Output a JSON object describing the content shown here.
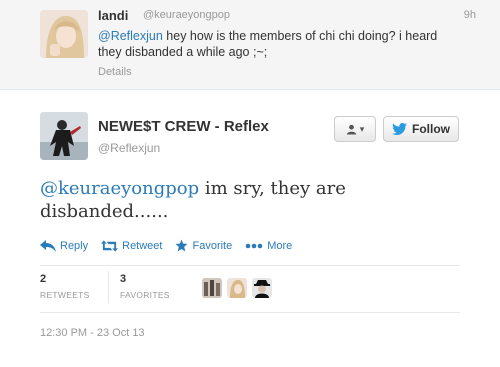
{
  "parent_tweet": {
    "name": "landi",
    "handle": "@keuraeyongpop",
    "time": "9h",
    "mention": "@Reflexjun",
    "text": " hey how is the members of chi chi doing? i heard they disbanded a while ago ;~;",
    "details_label": "Details"
  },
  "main_tweet": {
    "name": "NEWE$T CREW - Reflex",
    "handle": "@Reflexjun",
    "mention": "@keuraeyongpop",
    "text": " im sry, they are disbanded......",
    "follow_label": "Follow",
    "actions": {
      "reply": "Reply",
      "retweet": "Retweet",
      "favorite": "Favorite",
      "more": "More"
    },
    "stats": {
      "retweets_count": "2",
      "retweets_label": "RETWEETS",
      "favorites_count": "3",
      "favorites_label": "FAVORITES"
    },
    "timestamp": "12:30 PM - 23 Oct 13"
  },
  "colors": {
    "link": "#2b7bb9",
    "muted": "#999999",
    "text": "#333333",
    "parent_bg": "#f5f5f5"
  },
  "icons": [
    "reply-icon",
    "retweet-icon",
    "star-icon",
    "more-dots-icon",
    "user-icon",
    "twitter-bird-icon"
  ]
}
